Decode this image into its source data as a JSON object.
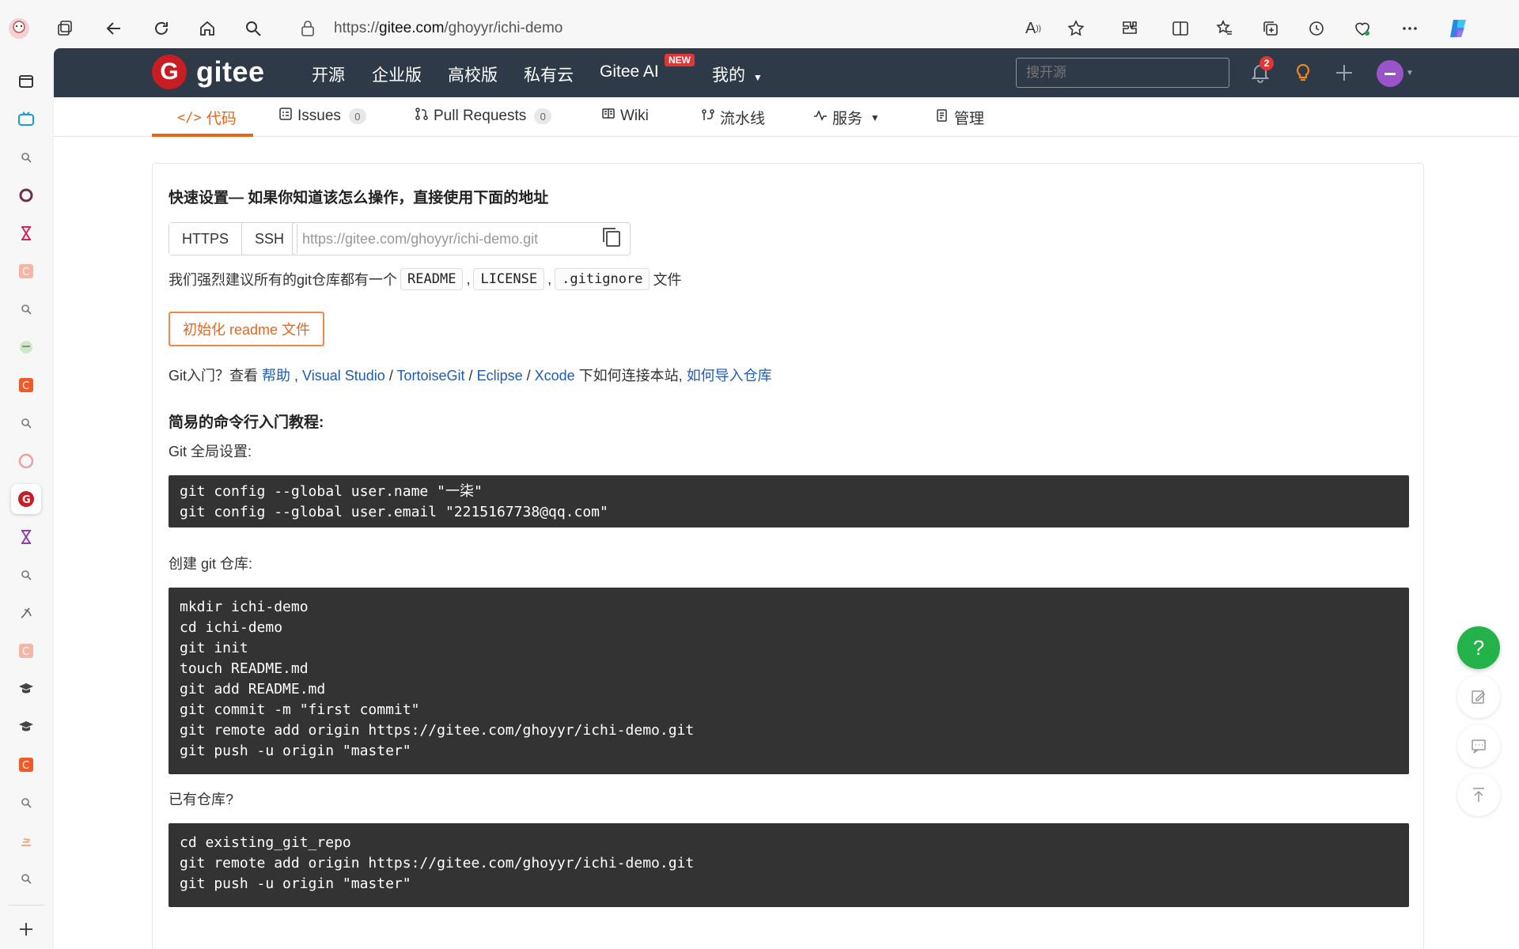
{
  "browser": {
    "url_prefix": "https://",
    "url_host": "gitee.com",
    "url_path": "/ghoyyr/ichi-demo",
    "read_aloud_label": "A"
  },
  "topnav": {
    "logo_text": "gitee",
    "logo_mark": "G",
    "links": [
      "开源",
      "企业版",
      "高校版",
      "私有云",
      "Gitee AI",
      "我的"
    ],
    "new_badge": "NEW",
    "search_placeholder": "搜开源",
    "notification_count": "2"
  },
  "tabs": {
    "code": "代码",
    "issues": "Issues",
    "issues_count": "0",
    "pull_requests": "Pull Requests",
    "pull_requests_count": "0",
    "wiki": "Wiki",
    "pipeline": "流水线",
    "services": "服务",
    "manage": "管理"
  },
  "quick_setup": {
    "title": "快速设置— 如果你知道该怎么操作，直接使用下面的地址",
    "https_label": "HTTPS",
    "ssh_label": "SSH",
    "clone_url": "https://gitee.com/ghoyyr/ichi-demo.git",
    "recommend_prefix": "我们强烈建议所有的git仓库都有一个",
    "readme_chip": "README",
    "comma": ",",
    "license_chip": "LICENSE",
    "gitignore_chip": ".gitignore",
    "recommend_suffix": "文件",
    "init_button": "初始化 readme 文件",
    "help_prefix": "Git入门？查看 ",
    "help_link": "帮助",
    "vs_link": "Visual Studio",
    "tortoise_link": "TortoiseGit",
    "eclipse_link": "Eclipse",
    "xcode_link": "Xcode",
    "help_middle": " 下如何连接本站, ",
    "import_link": "如何导入仓库"
  },
  "tutorial": {
    "title": "简易的命令行入门教程:",
    "global_label": "Git 全局设置:",
    "global_code": [
      "git config --global user.name \"一柒\"",
      "git config --global user.email \"2215167738@qq.com\""
    ],
    "create_label": "创建 git 仓库:",
    "create_code": [
      "mkdir ichi-demo",
      "cd ichi-demo",
      "git init",
      "touch README.md",
      "git add README.md",
      "git commit -m \"first commit\"",
      "git remote add origin https://gitee.com/ghoyyr/ichi-demo.git",
      "git push -u origin \"master\""
    ],
    "existing_label": "已有仓库?",
    "existing_code": [
      "cd existing_git_repo",
      "git remote add origin https://gitee.com/ghoyyr/ichi-demo.git",
      "git push -u origin \"master\""
    ]
  },
  "fab": {
    "help_label": "?"
  },
  "colors": {
    "nav_bg": "#2f3a49",
    "accent_orange": "#e8651a",
    "link_blue": "#1e5cb3",
    "code_bg": "#333333",
    "fab_green": "#24b24b",
    "brand_red": "#c71d23"
  }
}
